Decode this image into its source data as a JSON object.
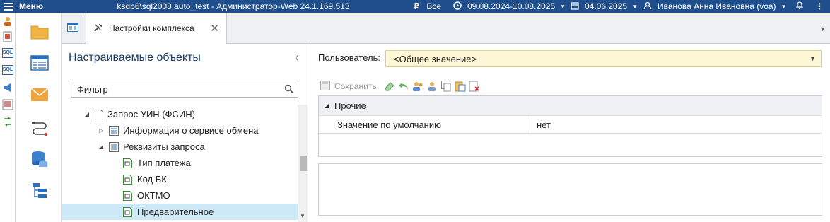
{
  "topbar": {
    "menu_label": "Меню",
    "title": "ksdb6\\sql2008.auto_test - Администратор-Web 24.1.169.513",
    "filter_label": "Все",
    "period": "09.08.2024-10.08.2025",
    "date": "04.06.2025",
    "user": "Иванова Анна Ивановна (voa)"
  },
  "strip1": {
    "icons": [
      "user-settings-icon",
      "document-icon",
      "sql-icon",
      "sql-icon",
      "megaphone-icon",
      "report-icon",
      "exchange-icon"
    ],
    "sql_text": "SQL"
  },
  "strip2": {
    "icons": [
      "folder-icon",
      "table-icon",
      "envelope-icon",
      "flow-icon",
      "database-icon",
      "tree-icon"
    ]
  },
  "tabs": [
    {
      "label": "Настройки комплекса"
    }
  ],
  "left_panel": {
    "title": "Настраиваемые объекты",
    "filter_placeholder": "Фильтр",
    "tree": [
      {
        "label": "Запрос УИН (ФСИН)",
        "level": 0,
        "toggle": "expanded",
        "icon": "page-icon"
      },
      {
        "label": "Информация о сервисе обмена",
        "level": 1,
        "toggle": "collapsed",
        "icon": "list-icon"
      },
      {
        "label": "Реквизиты запроса",
        "level": 1,
        "toggle": "expanded",
        "icon": "list-icon"
      },
      {
        "label": "Тип платежа",
        "level": 2,
        "toggle": "none",
        "icon": "field-icon"
      },
      {
        "label": "Код БК",
        "level": 2,
        "toggle": "none",
        "icon": "field-icon"
      },
      {
        "label": "ОКТМО",
        "level": 2,
        "toggle": "none",
        "icon": "field-icon"
      },
      {
        "label": "Предварительное",
        "level": 2,
        "toggle": "none",
        "icon": "field-icon",
        "selected": true
      }
    ]
  },
  "right_panel": {
    "user_label": "Пользователь:",
    "user_value": "<Общее значение>",
    "toolbar": {
      "save_label": "Сохранить"
    },
    "group": "Прочие",
    "properties": [
      {
        "name": "Значение по умолчанию",
        "value": "нет"
      }
    ]
  }
}
